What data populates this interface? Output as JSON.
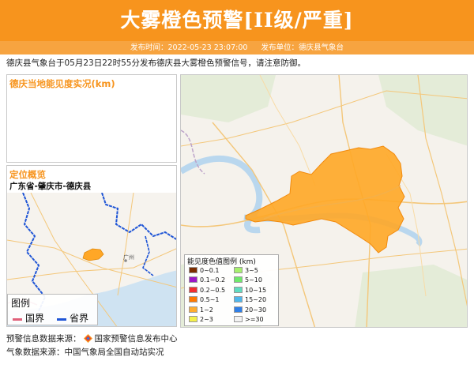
{
  "header": {
    "title": "大雾橙色预警[II级/严重]",
    "publish_time_label": "发布时间：2022-05-23 23:07:00",
    "publish_unit_label": "发布单位：德庆县气象台"
  },
  "notice": "德庆县气象台于05月23日22时55分发布德庆县大雾橙色预警信号，请注意防御。",
  "visibility_panel": {
    "title": "德庆当地能见度实况(km)"
  },
  "location_panel": {
    "title": "定位概览",
    "path": "广东省-肇庆市-德庆县",
    "city_label": "广州",
    "legend": {
      "title": "图例",
      "country": "国界",
      "province": "省界"
    }
  },
  "main_map": {
    "legend_title": "能见度色值图例 (km)",
    "legend_items": [
      {
        "label": "0~0.1",
        "color": "#7b2d00"
      },
      {
        "label": "3~5",
        "color": "#a6f06e"
      },
      {
        "label": "0.1~0.2",
        "color": "#9b18c7"
      },
      {
        "label": "5~10",
        "color": "#6fe96b"
      },
      {
        "label": "0.2~0.5",
        "color": "#f22f2f"
      },
      {
        "label": "10~15",
        "color": "#60dcc0"
      },
      {
        "label": "0.5~1",
        "color": "#ff7a00"
      },
      {
        "label": "15~20",
        "color": "#4fb7ec"
      },
      {
        "label": "1~2",
        "color": "#ffad2e"
      },
      {
        "label": "20~30",
        "color": "#2f7fe7"
      },
      {
        "label": "2~3",
        "color": "#f4f04a"
      },
      {
        "label": ">=30",
        "color": "#f2f2f2"
      }
    ]
  },
  "sources": {
    "warning_label": "预警信息数据来源：",
    "warning_source": "国家预警信息发布中心",
    "weather_label": "气象数据来源：中国气象局全国自动站实况"
  },
  "colors": {
    "banner": "#f7941d",
    "warning_area": "#ffa726",
    "province_border": "#1f55d6",
    "country_border": "#e0607a"
  }
}
